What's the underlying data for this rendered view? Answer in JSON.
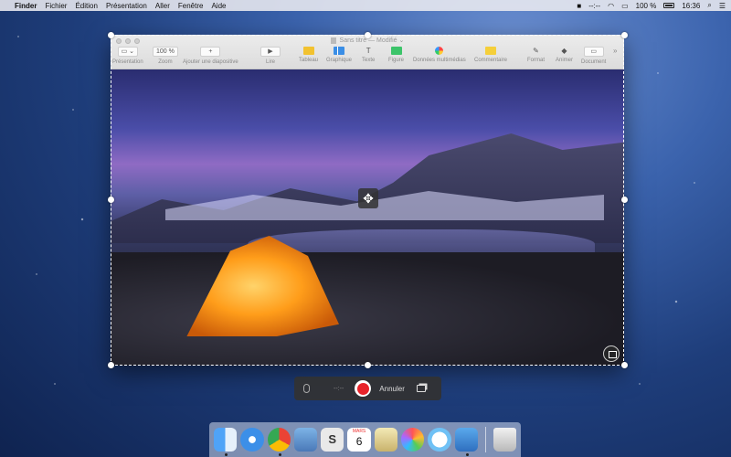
{
  "menubar": {
    "apple_icon": "apple-icon",
    "items": [
      "Finder",
      "Fichier",
      "Édition",
      "Présentation",
      "Aller",
      "Fenêtre",
      "Aide"
    ],
    "status": {
      "record_time": "--:--",
      "battery": "100 %",
      "clock": "16:36"
    }
  },
  "window": {
    "title": "Sans titre",
    "subtitle": "— Modifié",
    "toolbar": {
      "presentation": "Présentation",
      "zoom_value": "100 %",
      "zoom": "Zoom",
      "add_slide": "Ajouter une diapositive",
      "play": "Lire",
      "table": "Tableau",
      "chart": "Graphique",
      "text": "Texte",
      "shape": "Figure",
      "media": "Données multimédias",
      "comment": "Commentaire",
      "format": "Format",
      "animate": "Animer",
      "document": "Document"
    }
  },
  "recorder": {
    "time": "--:--",
    "cancel": "Annuler"
  },
  "dock": {
    "apps": [
      "Finder",
      "Safari",
      "Chrome",
      "Aperçu",
      "Sketch",
      "Calendrier",
      "Aperçu images",
      "Photos",
      "Messages",
      "Keynote",
      "Corbeille"
    ],
    "calendar_day": "6",
    "calendar_month": "MARS"
  }
}
